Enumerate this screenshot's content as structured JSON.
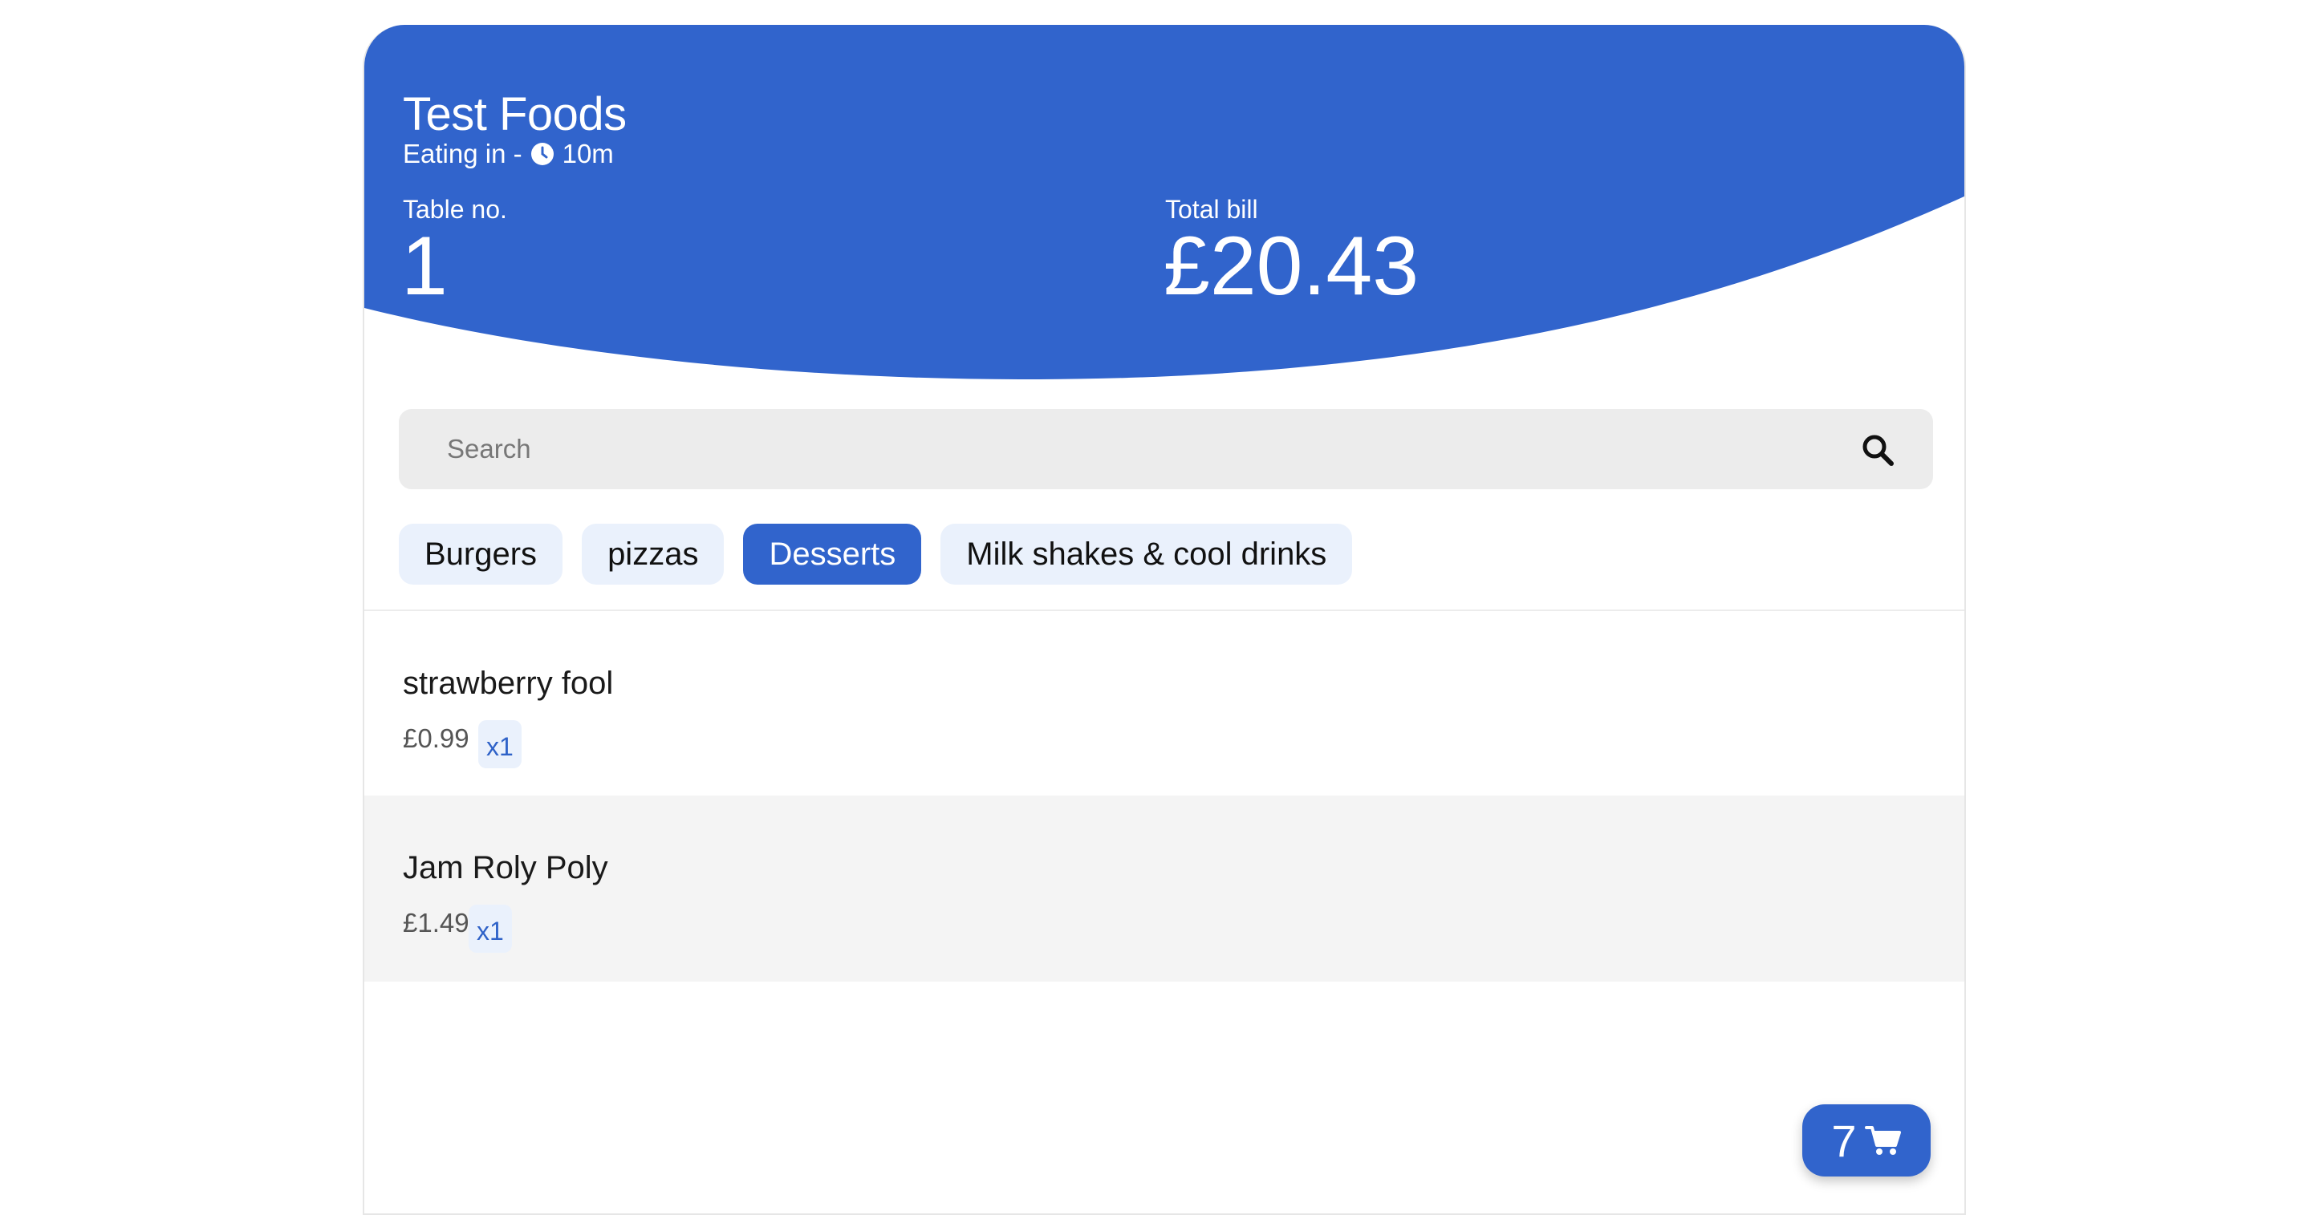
{
  "header": {
    "restaurant_name": "Test Foods",
    "dining_mode": "Eating in -",
    "wait_time": "10m",
    "table_label": "Table no.",
    "table_number": "1",
    "bill_label": "Total bill",
    "bill_total": "£20.43",
    "color": "#3164cc"
  },
  "search": {
    "placeholder": "Search",
    "value": ""
  },
  "categories": [
    {
      "label": "Burgers",
      "active": false
    },
    {
      "label": "pizzas",
      "active": false
    },
    {
      "label": "Desserts",
      "active": true
    },
    {
      "label": "Milk shakes & cool drinks",
      "active": false
    }
  ],
  "items": [
    {
      "name": "strawberry fool",
      "price": "£0.99",
      "qty": "x1"
    },
    {
      "name": "Jam Roly Poly",
      "price": "£1.49",
      "qty": "x1"
    }
  ],
  "cart": {
    "count": "7",
    "icon": "cart-icon"
  },
  "icons": {
    "clock": "clock-icon",
    "search": "search-icon"
  },
  "colors": {
    "accent": "#3164cc",
    "chip_bg": "#eaf1fc",
    "search_bg": "#ececec",
    "alt_row_bg": "#f4f4f4"
  }
}
